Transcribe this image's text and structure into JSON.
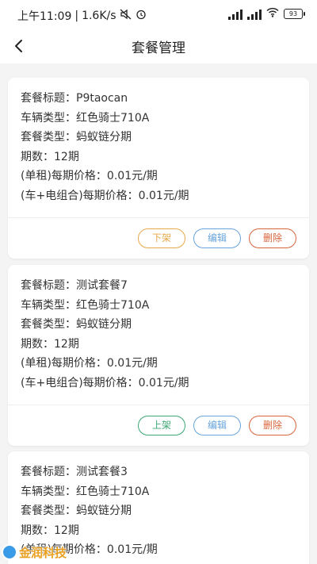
{
  "status_bar": {
    "time": "上午11:09",
    "network_speed": "1.6K/s",
    "battery_level": "93"
  },
  "header": {
    "title": "套餐管理"
  },
  "packages": [
    {
      "title_line": "套餐标题：P9taocan",
      "vehicle_line": "车辆类型：红色骑士710A",
      "type_line": "套餐类型：蚂蚁链分期",
      "periods_line": "期数：12期",
      "single_price_line": "(单租)每期价格：0.01元/期",
      "combo_price_line": "(车+电组合)每期价格：0.01元/期",
      "toggle_label": "下架",
      "edit_label": "编辑",
      "delete_label": "删除"
    },
    {
      "title_line": "套餐标题：测试套餐7",
      "vehicle_line": "车辆类型：红色骑士710A",
      "type_line": "套餐类型：蚂蚁链分期",
      "periods_line": "期数：12期",
      "single_price_line": "(单租)每期价格：0.01元/期",
      "combo_price_line": "(车+电组合)每期价格：0.01元/期",
      "toggle_label": "上架",
      "edit_label": "编辑",
      "delete_label": "删除"
    },
    {
      "title_line": "套餐标题：测试套餐3",
      "vehicle_line": "车辆类型：红色骑士710A",
      "type_line": "套餐类型：蚂蚁链分期",
      "periods_line": "期数：12期",
      "single_price_line": "(单租)每期价格：0.01元/期"
    }
  ],
  "watermark": {
    "text": "金润科技"
  },
  "colors": {
    "unlist_button": "#e6a94a",
    "list_button": "#3aa874",
    "edit_button": "#68a4dc",
    "delete_button": "#d9643a",
    "background": "#f4f4f4"
  }
}
